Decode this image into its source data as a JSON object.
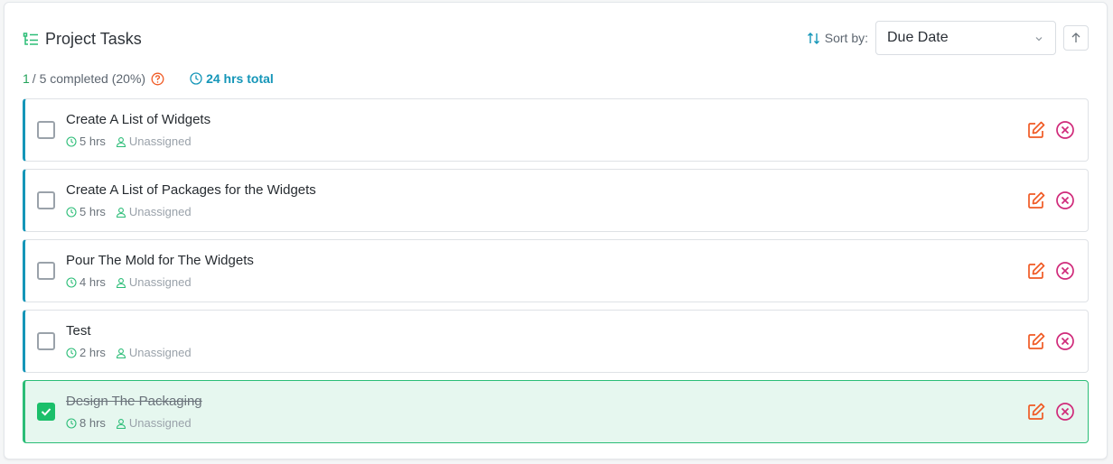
{
  "header": {
    "title": "Project Tasks",
    "title_icon": "task-list-icon",
    "sort_label": "Sort by:",
    "sort_icon": "sort-arrows-icon",
    "sort_value": "Due Date",
    "sort_options": [
      "Due Date"
    ],
    "sort_direction_icon": "arrow-up-icon"
  },
  "stats": {
    "completed": "1",
    "rest": "/ 5 completed (20%)",
    "total_hours": "24 hrs total",
    "help_icon": "question-circle-icon"
  },
  "tasks": [
    {
      "name": "Create A List of Widgets",
      "hours": "5 hrs",
      "assignee": "Unassigned",
      "completed": false
    },
    {
      "name": "Create A List of Packages for the Widgets",
      "hours": "5 hrs",
      "assignee": "Unassigned",
      "completed": false
    },
    {
      "name": "Pour The Mold for The Widgets",
      "hours": "4 hrs",
      "assignee": "Unassigned",
      "completed": false
    },
    {
      "name": "Test",
      "hours": "2 hrs",
      "assignee": "Unassigned",
      "completed": false
    },
    {
      "name": "Design The Packaging",
      "hours": "8 hrs",
      "assignee": "Unassigned",
      "completed": true
    }
  ],
  "colors": {
    "accent": "#1596b8",
    "success": "#1bbf6a",
    "edit": "#f05a24",
    "delete": "#d02a7a",
    "completed_bg": "#e6f7ef"
  }
}
